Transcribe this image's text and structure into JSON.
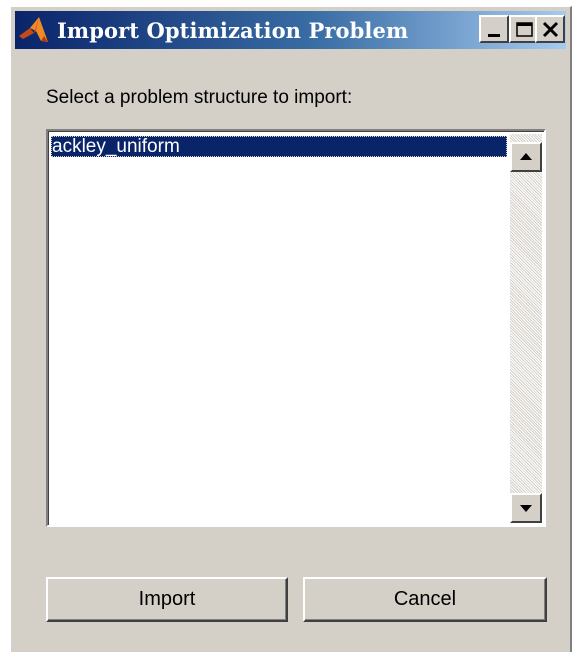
{
  "window": {
    "title": "Import Optimization Problem"
  },
  "titlebar_buttons": {
    "minimize": "minimize-icon",
    "maximize": "maximize-icon",
    "close": "close-icon"
  },
  "dialog": {
    "prompt": "Select a problem structure to import:",
    "items": [
      {
        "label": "ackley_uniform",
        "selected": true
      }
    ]
  },
  "buttons": {
    "import_label": "Import",
    "cancel_label": "Cancel"
  },
  "colors": {
    "titlebar_start": "#0a246a",
    "titlebar_end": "#a6caf0",
    "selection": "#0a246a",
    "face": "#d4d0c8"
  }
}
